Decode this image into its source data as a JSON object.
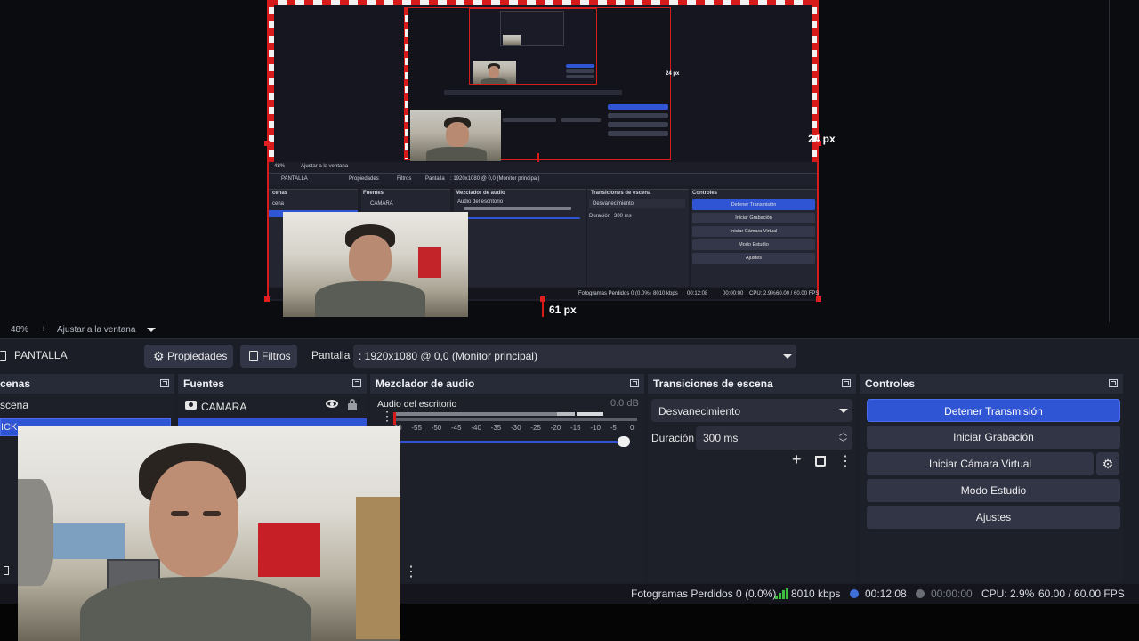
{
  "preview": {
    "size_label_right": "24 px",
    "size_label_bottom": "61 px",
    "inner": {
      "zoom": "48%",
      "fit_label": "Ajustar a la ventana",
      "source_name": "PANTALLA",
      "properties": "Propiedades",
      "filters": "Filtros",
      "display_label": "Pantalla",
      "display_value": ": 1920x1080 @ 0,0 (Monitor principal)",
      "scenes_title": "cenas",
      "scene_item": "cena",
      "sources_title": "Fuentes",
      "source_item": "CAMARA",
      "mixer_title": "Mezclador de audio",
      "mixer_item": "Audio del escritorio",
      "transitions_title": "Transiciones de escena",
      "transition_value": "Desvanecimiento",
      "duration_label": "Duración",
      "duration_value": "300 ms",
      "controls_title": "Controles",
      "buttons": [
        "Detener Transmisión",
        "Iniciar Grabación",
        "Iniciar Cámara Virtual",
        "Modo Estudio",
        "Ajustes"
      ],
      "status": "Fotogramas Perdidos 0 (0.0%)",
      "bitrate": "8010 kbps",
      "time1": "00:12:08",
      "time2": "00:00:00",
      "cpu": "CPU: 2.9%",
      "fps": "60.00 / 60.00 FPS",
      "guide_label": "61 px"
    }
  },
  "zoombar": {
    "zoom": "48%",
    "plus": "+",
    "fit_label": "Ajustar a la ventana"
  },
  "context": {
    "source_name": "PANTALLA",
    "properties_label": "Propiedades",
    "filters_label": "Filtros",
    "display_label": "Pantalla",
    "display_value": ": 1920x1080 @ 0,0 (Monitor principal)"
  },
  "scenes": {
    "title": "cenas",
    "items": [
      "scena",
      "ICK"
    ]
  },
  "sources": {
    "title": "Fuentes",
    "items": [
      {
        "name": "CAMARA",
        "icon": "camera-icon"
      }
    ]
  },
  "mixer": {
    "title": "Mezclador de audio",
    "channel_name": "Audio del escritorio",
    "level_value": "0.0 dB",
    "ticks": [
      "-60",
      "-55",
      "-50",
      "-45",
      "-40",
      "-35",
      "-30",
      "-25",
      "-20",
      "-15",
      "-10",
      "-5",
      "0"
    ],
    "volume_fraction": 1.0
  },
  "transitions": {
    "title": "Transiciones de escena",
    "selected": "Desvanecimiento",
    "duration_label": "Duración",
    "duration_value": "300 ms"
  },
  "controls": {
    "title": "Controles",
    "buttons": [
      "Detener Transmisión",
      "Iniciar Grabación",
      "Iniciar Cámara Virtual",
      "Modo Estudio",
      "Ajustes"
    ],
    "accent": "#2f55d4"
  },
  "status": {
    "dropped": "Fotogramas Perdidos 0 (0.0%)",
    "bitrate": "8010 kbps",
    "stream_time": "00:12:08",
    "record_time": "00:00:00",
    "cpu": "CPU: 2.9%",
    "fps": "60.00 / 60.00 FPS"
  }
}
